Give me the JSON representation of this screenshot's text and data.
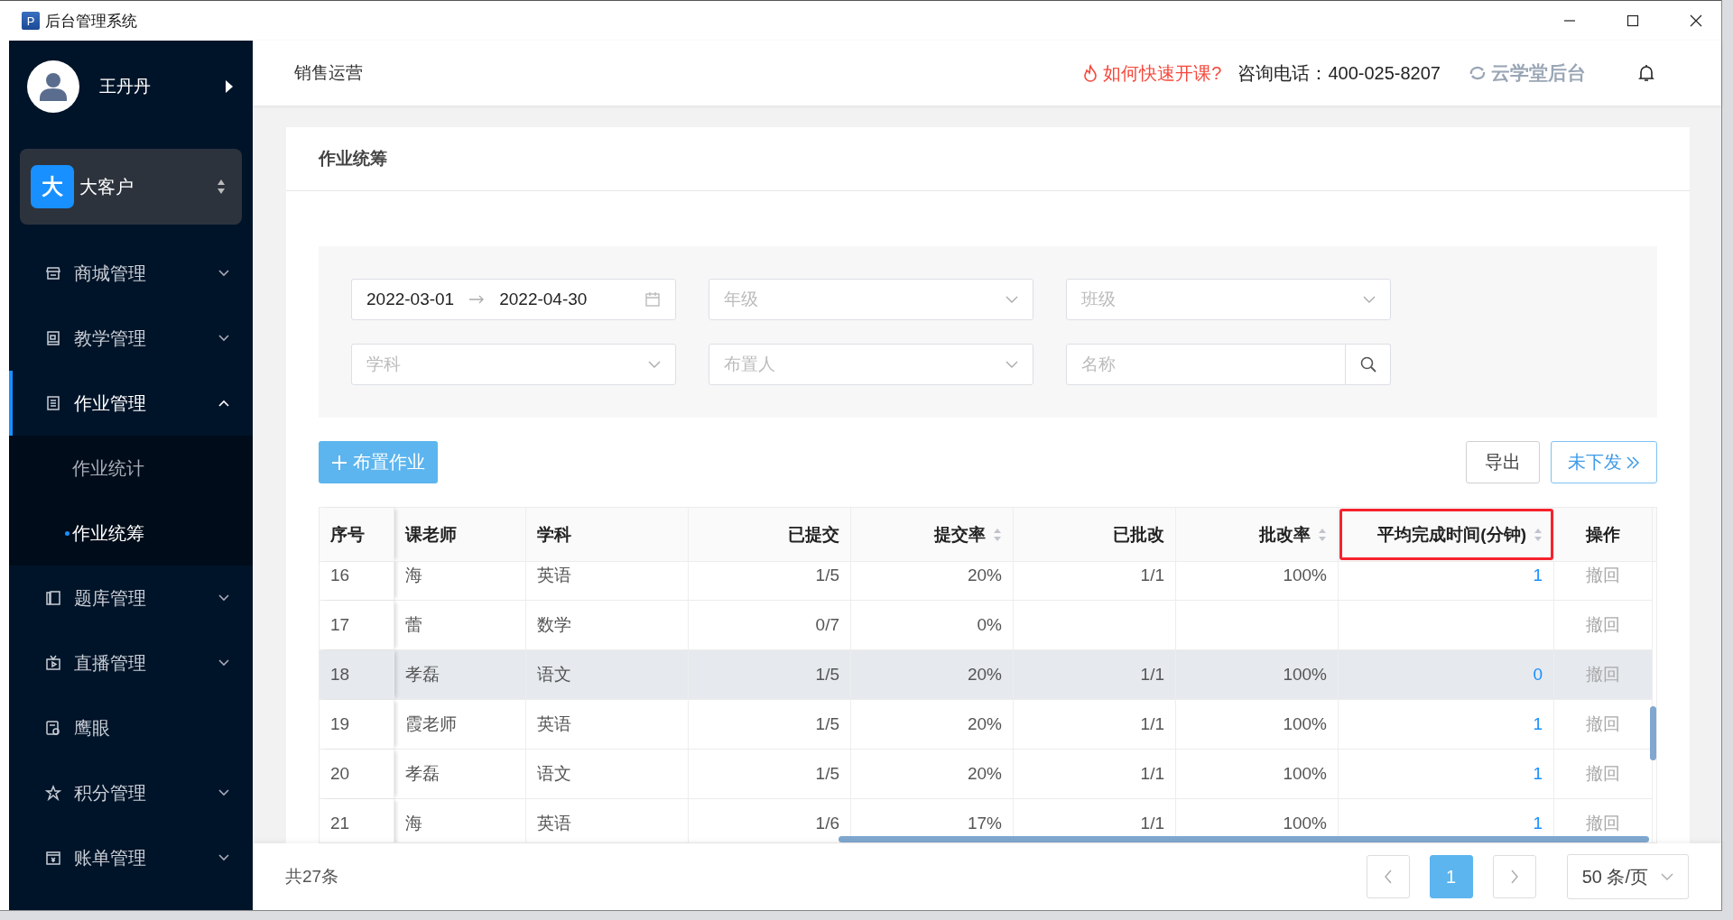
{
  "window": {
    "app_icon": "P",
    "title": "后台管理系统"
  },
  "header": {
    "section": "销售运营",
    "help_link": "如何快速开课?",
    "phone": "咨询电话：400-025-8207",
    "brand": "云学堂后台"
  },
  "sidebar": {
    "user": {
      "name": "王丹丹"
    },
    "org": {
      "badge": "大",
      "name": "大客户"
    },
    "items": [
      {
        "label": "商城管理",
        "kind": "submenu",
        "expanded": false,
        "selected": false
      },
      {
        "label": "教学管理",
        "kind": "submenu",
        "expanded": false,
        "selected": false
      },
      {
        "label": "作业管理",
        "kind": "submenu",
        "expanded": true,
        "selected": true,
        "children": [
          {
            "label": "作业统计",
            "selected": false
          },
          {
            "label": "作业统筹",
            "selected": true
          }
        ]
      },
      {
        "label": "题库管理",
        "kind": "submenu",
        "expanded": false,
        "selected": false
      },
      {
        "label": "直播管理",
        "kind": "submenu",
        "expanded": false,
        "selected": false
      },
      {
        "label": "鹰眼",
        "kind": "link",
        "selected": false
      },
      {
        "label": "积分管理",
        "kind": "submenu",
        "expanded": false,
        "selected": false
      },
      {
        "label": "账单管理",
        "kind": "submenu",
        "expanded": false,
        "selected": false
      }
    ]
  },
  "page": {
    "title": "作业统筹"
  },
  "filters": {
    "date_start": "2022-03-01",
    "date_end": "2022-04-30",
    "selects": [
      {
        "placeholder": "年级"
      },
      {
        "placeholder": "班级"
      },
      {
        "placeholder": "学科"
      },
      {
        "placeholder": "布置人"
      }
    ],
    "search": {
      "placeholder": "名称"
    }
  },
  "actions": {
    "primary": "布置作业",
    "export": "导出",
    "pending": "未下发"
  },
  "table": {
    "columns": [
      {
        "label": "序号",
        "kind": "text",
        "sortable": false,
        "highlighted": false
      },
      {
        "label": "课老师",
        "kind": "text",
        "sortable": false,
        "highlighted": false
      },
      {
        "label": "学科",
        "kind": "text",
        "sortable": false,
        "highlighted": false
      },
      {
        "label": "已提交",
        "kind": "number",
        "sortable": false,
        "highlighted": false
      },
      {
        "label": "提交率",
        "kind": "number",
        "sortable": true,
        "highlighted": false
      },
      {
        "label": "已批改",
        "kind": "number",
        "sortable": false,
        "highlighted": false
      },
      {
        "label": "批改率",
        "kind": "number",
        "sortable": true,
        "highlighted": false
      },
      {
        "label": "平均完成时间(分钟)",
        "kind": "link",
        "sortable": true,
        "highlighted": true
      },
      {
        "label": "操作",
        "kind": "action",
        "sortable": false,
        "highlighted": false
      }
    ],
    "rows": [
      {
        "cells": [
          "16",
          "海",
          "英语",
          "1/5",
          "20%",
          "1/1",
          "100%",
          "1",
          "撤回"
        ],
        "hovered": false,
        "action_disabled": true
      },
      {
        "cells": [
          "17",
          "蕾",
          "数学",
          "0/7",
          "0%",
          null,
          null,
          null,
          "撤回"
        ],
        "hovered": false,
        "action_disabled": true
      },
      {
        "cells": [
          "18",
          "孝磊",
          "语文",
          "1/5",
          "20%",
          "1/1",
          "100%",
          "0",
          "撤回"
        ],
        "hovered": true,
        "action_disabled": true
      },
      {
        "cells": [
          "19",
          "霞老师",
          "英语",
          "1/5",
          "20%",
          "1/1",
          "100%",
          "1",
          "撤回"
        ],
        "hovered": false,
        "action_disabled": true
      },
      {
        "cells": [
          "20",
          "孝磊",
          "语文",
          "1/5",
          "20%",
          "1/1",
          "100%",
          "1",
          "撤回"
        ],
        "hovered": false,
        "action_disabled": true
      },
      {
        "cells": [
          "21",
          "海",
          "英语",
          "1/6",
          "17%",
          "1/1",
          "100%",
          "1",
          "撤回"
        ],
        "hovered": false,
        "action_disabled": true
      }
    ]
  },
  "footer": {
    "total": "共27条",
    "pages": [
      {
        "label": "1",
        "selected": true
      }
    ],
    "page_size": "50 条/页"
  }
}
